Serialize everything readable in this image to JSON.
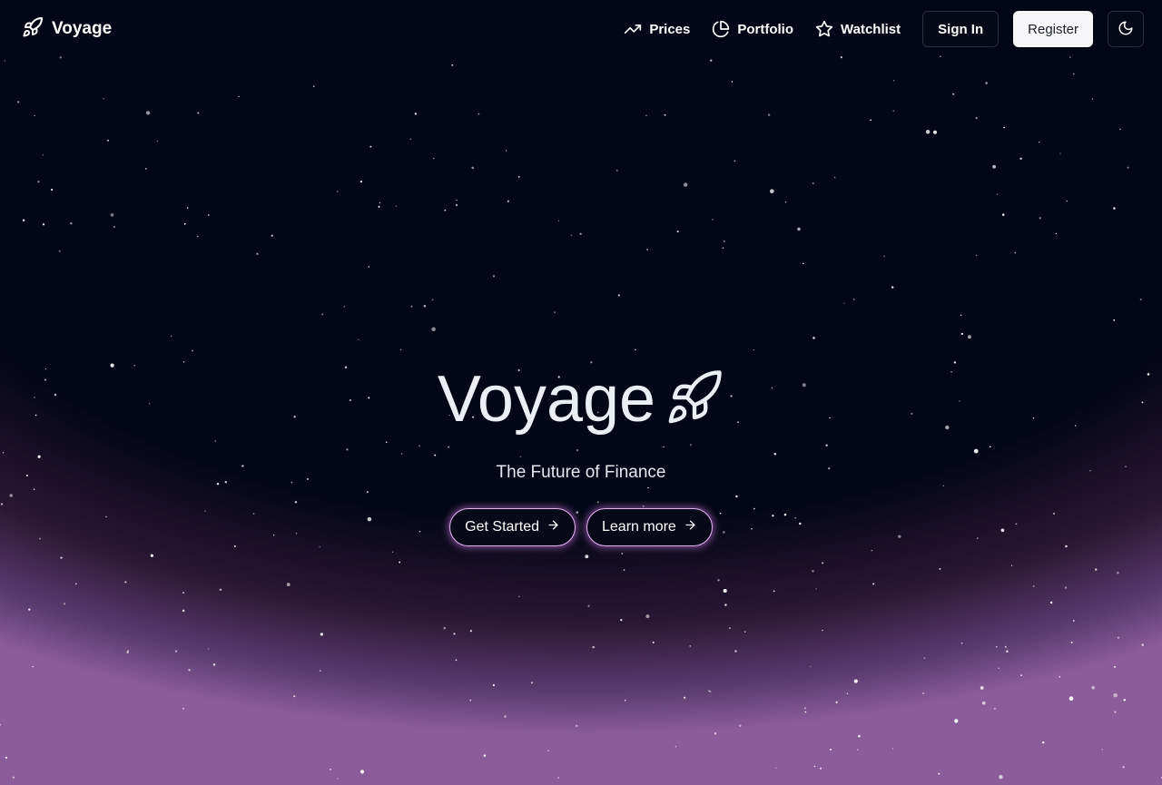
{
  "brand": {
    "name": "Voyage",
    "icon": "rocket-icon"
  },
  "nav": {
    "links": [
      {
        "label": "Prices",
        "icon": "trending-up-icon"
      },
      {
        "label": "Portfolio",
        "icon": "pie-chart-icon"
      },
      {
        "label": "Watchlist",
        "icon": "star-icon"
      }
    ],
    "sign_in_label": "Sign In",
    "register_label": "Register",
    "theme_toggle_icon": "moon-icon"
  },
  "hero": {
    "title": "Voyage",
    "title_icon": "rocket-icon",
    "subtitle": "The Future of Finance",
    "primary_cta": "Get Started",
    "secondary_cta": "Learn more"
  },
  "colors": {
    "background": "#030616",
    "glow_purple": "#8a5c9a",
    "cta_border": "#e2b4ee",
    "register_bg": "#f7f7f9"
  }
}
